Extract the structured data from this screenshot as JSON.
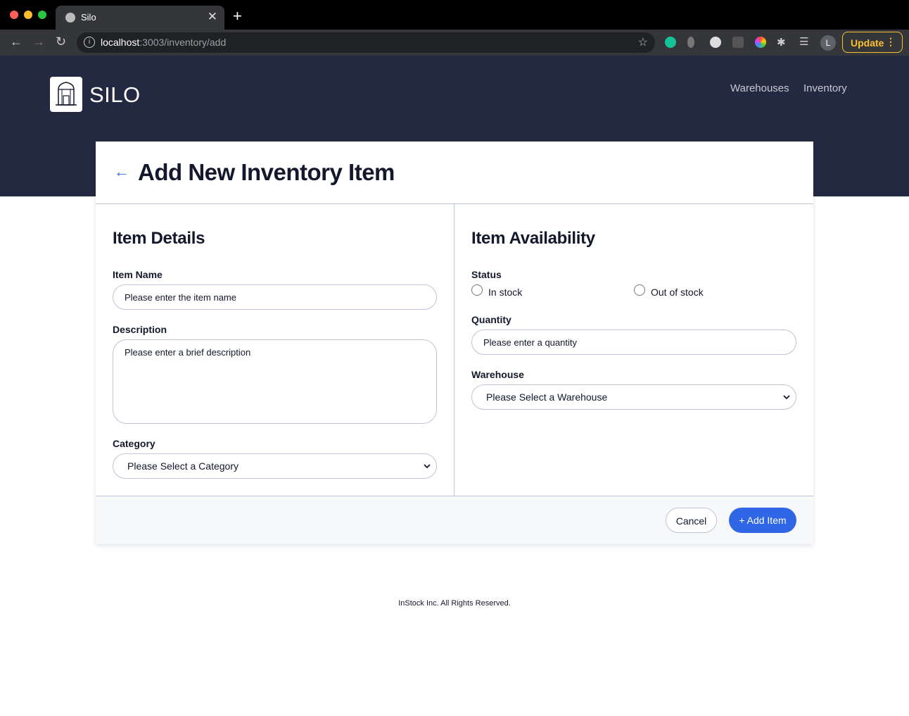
{
  "browser": {
    "tab_title": "Silo",
    "url_host": "localhost",
    "url_path": ":3003/inventory/add",
    "update_label": "Update",
    "profile_initial": "L"
  },
  "header": {
    "logo_text": "SILO",
    "nav": [
      "Warehouses",
      "Inventory"
    ]
  },
  "page": {
    "title": "Add New Inventory Item"
  },
  "item_details": {
    "title": "Item Details",
    "name_label": "Item Name",
    "name_placeholder": "Please enter the item name",
    "description_label": "Description",
    "description_placeholder": "Please enter a brief description",
    "category_label": "Category",
    "category_selected": "Please Select a Category"
  },
  "item_availability": {
    "title": "Item Availability",
    "status_label": "Status",
    "status_options": [
      "In stock",
      "Out of stock"
    ],
    "quantity_label": "Quantity",
    "quantity_placeholder": "Please enter a quantity",
    "warehouse_label": "Warehouse",
    "warehouse_selected": "Please Select a Warehouse"
  },
  "actions": {
    "cancel_label": "Cancel",
    "add_label": "+ Add Item"
  },
  "footer": {
    "text": "InStock Inc. All Rights Reserved."
  },
  "colors": {
    "header_bg": "#232940",
    "primary": "#2e66e6",
    "text": "#13182c",
    "border": "#bdc5d5"
  }
}
